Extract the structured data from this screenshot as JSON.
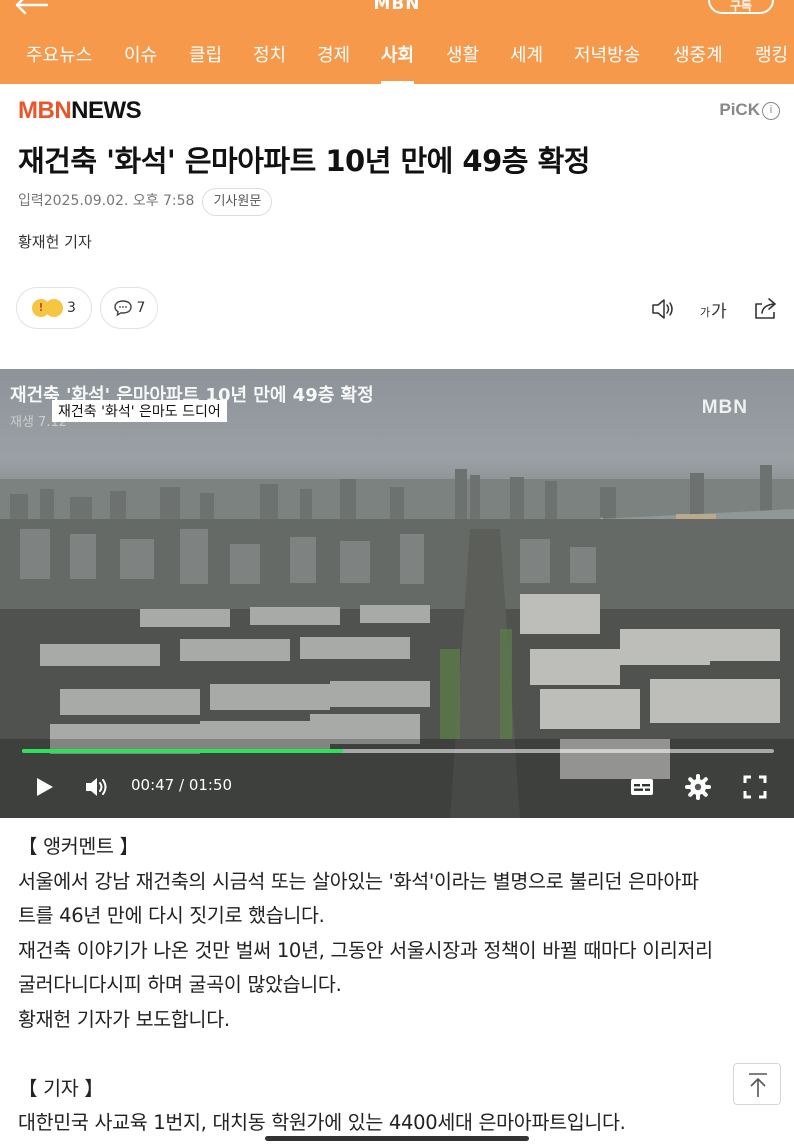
{
  "header": {
    "logo": "MBN",
    "subscribe_label": "구독",
    "tabs": [
      {
        "label": "주요뉴스",
        "active": false
      },
      {
        "label": "이슈",
        "active": false
      },
      {
        "label": "클립",
        "active": false
      },
      {
        "label": "정치",
        "active": false
      },
      {
        "label": "경제",
        "active": false
      },
      {
        "label": "사회",
        "active": true
      },
      {
        "label": "생활",
        "active": false
      },
      {
        "label": "세계",
        "active": false
      },
      {
        "label": "저녁방송",
        "active": false
      },
      {
        "label": "생중계",
        "active": false
      },
      {
        "label": "랭킹",
        "active": false
      }
    ]
  },
  "article": {
    "brand_mbn": "MBN",
    "brand_news": "NEWS",
    "pick_label": "PiCK",
    "title": "재건축 '화석' 은마아파트 10년 만에 49층 확정",
    "date": "입력2025.09.02. 오후 7:58",
    "origin_label": "기사원문",
    "reporter": "황재헌 기자",
    "reaction_count": "3",
    "comment_count": "7"
  },
  "video": {
    "overlay_title": "재건축 '화석' 은마아파트 10년 만에 49층 확정",
    "caption": "재건축 '화석' 은마도 드디어",
    "replay_text": "재생 7.12",
    "logo": "MBN",
    "current_time": "00:47",
    "duration": "01:50",
    "time_display": "00:47 / 01:50",
    "progress_fraction": 0.427
  },
  "body": {
    "lines": [
      "【 앵커멘트 】",
      "서울에서 강남 재건축의 시금석 또는 살아있는 '화석'이라는 별명으로 불리던 은마아파",
      "트를 46년 만에 다시 짓기로 했습니다.",
      "재건축 이야기가 나온 것만 벌써 10년, 그동안 서울시장과 정책이 바뀔 때마다 이리저리",
      "굴러다니다시피 하며 굴곡이 많았습니다.",
      "황재헌 기자가 보도합니다.",
      "",
      "【 기자 】",
      "대한민국 사교육 1번지, 대치동 학원가에 있는 4400세대 은마아파트입니다."
    ]
  },
  "colors": {
    "header_bg": "#f7994a",
    "brand_red": "#e8562a",
    "progress_green": "#2ee05a"
  }
}
